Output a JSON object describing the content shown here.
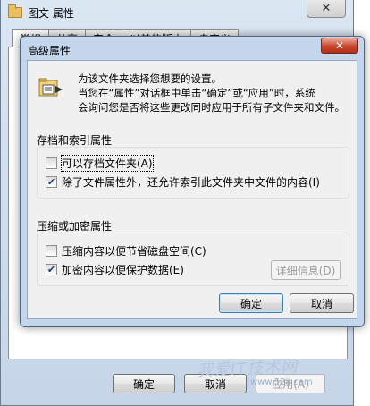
{
  "back_window": {
    "title": "图文 属性",
    "close_label": "✕",
    "tabs": [
      "常规",
      "共享",
      "安全",
      "以前的版本",
      "自定义"
    ],
    "buttons": {
      "ok": "确定",
      "cancel": "取消",
      "apply": "应用(A)"
    }
  },
  "dialog": {
    "title": "高级属性",
    "close_label": "✕",
    "description_line1": "为该文件夹选择您想要的设置。",
    "description_line2": "当您在“属性”对话框中单击“确定”或“应用”时，系统",
    "description_line3": "会询问您是否将这些更改同时应用于所有子文件夹和文件。",
    "archive_group": {
      "label": "存档和索引属性",
      "archive_option": {
        "label": "可以存档文件夹(A)",
        "checked": false
      },
      "index_option": {
        "label": "除了文件属性外，还允许索引此文件夹中文件的内容(I)",
        "checked": true
      }
    },
    "compress_group": {
      "label": "压缩或加密属性",
      "compress_option": {
        "label": "压缩内容以便节省磁盘空间(C)",
        "checked": false
      },
      "encrypt_option": {
        "label": "加密内容以便保护数据(E)",
        "checked": true
      },
      "details_button": "详细信息(D)"
    },
    "buttons": {
      "ok": "确定",
      "cancel": "取消"
    }
  },
  "watermark": {
    "main": "我爱IT技术网",
    "sub": "www.52ij.com"
  }
}
